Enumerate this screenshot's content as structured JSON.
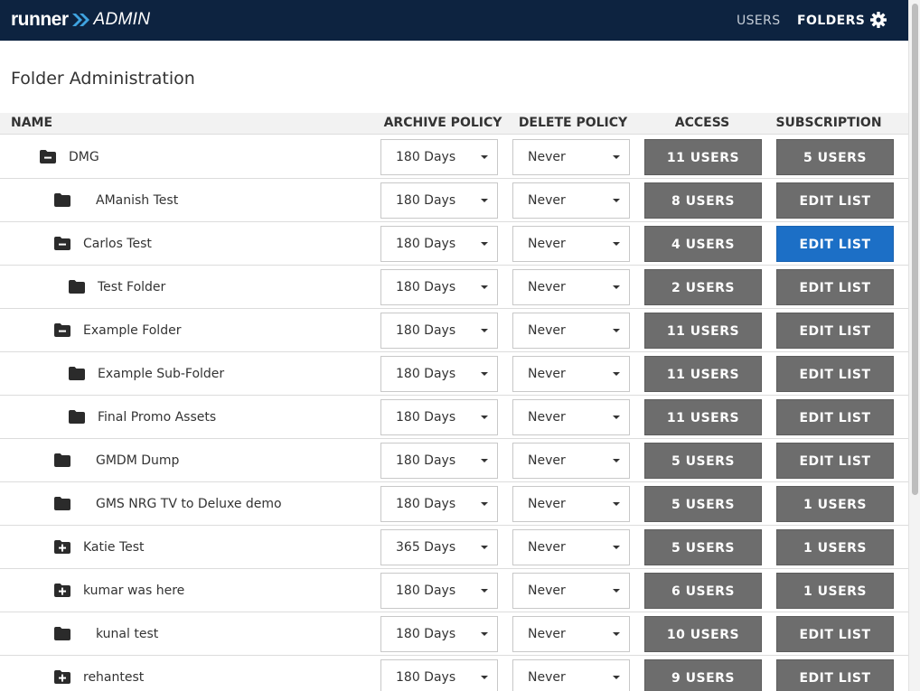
{
  "header": {
    "brand_runner": "runner",
    "brand_admin": "ADMIN",
    "nav_users": "USERS",
    "nav_folders": "FOLDERS",
    "settings_icon": "gear-icon",
    "bg_color": "#0d2340"
  },
  "page": {
    "title": "Folder Administration"
  },
  "columns": {
    "name": "NAME",
    "archive": "ARCHIVE POLICY",
    "delete": "DELETE POLICY",
    "access": "ACCESS",
    "subscription": "SUBSCRIPTION"
  },
  "colors": {
    "button_gray": "#6d6d6d",
    "button_active": "#1c6fc6"
  },
  "rows": [
    {
      "name": "DMG",
      "level": 0,
      "icon": "folder-minus-icon",
      "archive": "180 Days",
      "delete": "Never",
      "access": "11 USERS",
      "subscription": "5 USERS",
      "active": false
    },
    {
      "name": "AManish Test",
      "level": 1,
      "icon": "folder-icon",
      "archive": "180 Days",
      "delete": "Never",
      "access": "8 USERS",
      "subscription": "EDIT LIST",
      "active": false
    },
    {
      "name": "Carlos Test",
      "level": 1,
      "icon": "folder-minus-icon",
      "archive": "180 Days",
      "delete": "Never",
      "access": "4 USERS",
      "subscription": "EDIT LIST",
      "active": true
    },
    {
      "name": "Test Folder",
      "level": 2,
      "icon": "folder-icon",
      "archive": "180 Days",
      "delete": "Never",
      "access": "2 USERS",
      "subscription": "EDIT LIST",
      "active": false
    },
    {
      "name": "Example Folder",
      "level": 1,
      "icon": "folder-minus-icon",
      "archive": "180 Days",
      "delete": "Never",
      "access": "11 USERS",
      "subscription": "EDIT LIST",
      "active": false
    },
    {
      "name": "Example Sub-Folder",
      "level": 2,
      "icon": "folder-icon",
      "archive": "180 Days",
      "delete": "Never",
      "access": "11 USERS",
      "subscription": "EDIT LIST",
      "active": false
    },
    {
      "name": "Final Promo Assets",
      "level": 2,
      "icon": "folder-icon",
      "archive": "180 Days",
      "delete": "Never",
      "access": "11 USERS",
      "subscription": "EDIT LIST",
      "active": false
    },
    {
      "name": "GMDM Dump",
      "level": 1,
      "icon": "folder-icon",
      "archive": "180 Days",
      "delete": "Never",
      "access": "5 USERS",
      "subscription": "EDIT LIST",
      "active": false
    },
    {
      "name": "GMS NRG TV to Deluxe demo",
      "level": 1,
      "icon": "folder-icon",
      "archive": "180 Days",
      "delete": "Never",
      "access": "5 USERS",
      "subscription": "1 USERS",
      "active": false
    },
    {
      "name": "Katie Test",
      "level": 1,
      "icon": "folder-plus-icon",
      "archive": "365 Days",
      "delete": "Never",
      "access": "5 USERS",
      "subscription": "1 USERS",
      "active": false
    },
    {
      "name": "kumar was here",
      "level": 1,
      "icon": "folder-plus-icon",
      "archive": "180 Days",
      "delete": "Never",
      "access": "6 USERS",
      "subscription": "1 USERS",
      "active": false
    },
    {
      "name": "kunal test",
      "level": 1,
      "icon": "folder-icon",
      "archive": "180 Days",
      "delete": "Never",
      "access": "10 USERS",
      "subscription": "EDIT LIST",
      "active": false
    },
    {
      "name": "rehantest",
      "level": 1,
      "icon": "folder-plus-icon",
      "archive": "180 Days",
      "delete": "Never",
      "access": "9 USERS",
      "subscription": "EDIT LIST",
      "active": false
    }
  ]
}
